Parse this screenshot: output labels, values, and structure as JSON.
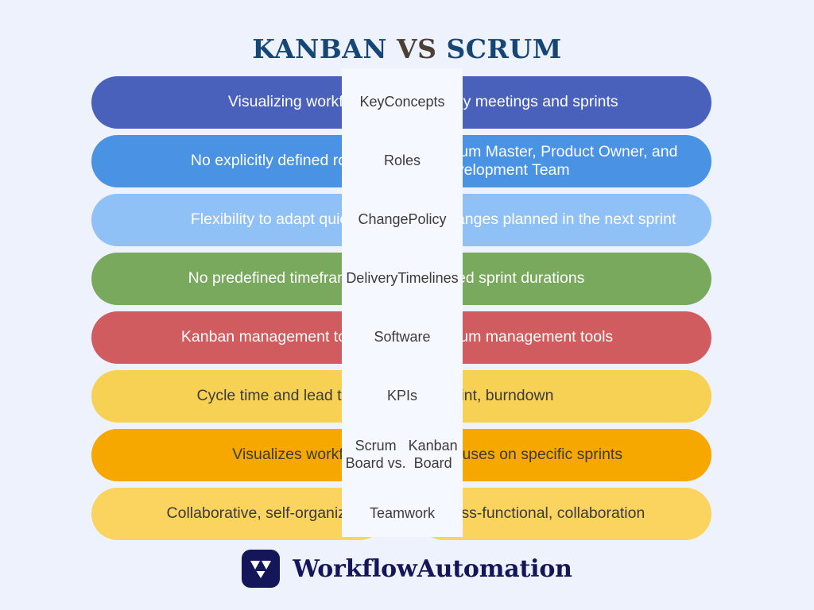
{
  "title": {
    "part1": "KANBAN",
    "vs": "VS",
    "part2": "SCRUM"
  },
  "theme": {
    "background": "#eef2fd",
    "center_panel": "#f5f8fe",
    "title_color": "#164675",
    "vs_color": "#4c4034",
    "logo_color": "#151559"
  },
  "comparison": {
    "rows": [
      {
        "label": "Key\nConcepts",
        "label_line1": "Key",
        "label_line2": "Concepts",
        "kanban": "Visualizing workflow",
        "scrum": "Daily meetings and sprints",
        "color": "#4a61bb",
        "text_color": "#ffffff"
      },
      {
        "label": "Roles",
        "label_line1": "Roles",
        "label_line2": "",
        "kanban": "No explicitly defined roles",
        "scrum": "Scrum Master, Product Owner, and Development Team",
        "color": "#4a93e4",
        "text_color": "#ffffff"
      },
      {
        "label": "Change\nPolicy",
        "label_line1": "Change",
        "label_line2": "Policy",
        "kanban": "Flexibility to adapt quickly",
        "scrum": "Changes planned in the next sprint",
        "color": "#8fc1f6",
        "text_color": "#ffffff"
      },
      {
        "label": "Delivery\nTimelines",
        "label_line1": "Delivery",
        "label_line2": "Timelines",
        "kanban": "No predefined timeframes",
        "scrum": "Fixed sprint durations",
        "color": "#78a95d",
        "text_color": "#ffffff"
      },
      {
        "label": "Software",
        "label_line1": "Software",
        "label_line2": "",
        "kanban": "Kanban management tools",
        "scrum": "Scrum management tools",
        "color": "#d15c5f",
        "text_color": "#ffffff"
      },
      {
        "label": "KPIs",
        "label_line1": "KPIs",
        "label_line2": "",
        "kanban": "Cycle time and lead time",
        "scrum": "Sprint, burndown",
        "color": "#f7d154",
        "text_color": "#3b3b3b"
      },
      {
        "label": "Scrum Board vs.\nKanban Board",
        "label_line1": "Scrum Board vs.",
        "label_line2": "Kanban Board",
        "kanban": "Visualizes workflow",
        "scrum": "Focuses on specific sprints",
        "color": "#f7a800",
        "text_color": "#3b3b3b"
      },
      {
        "label": "Teamwork",
        "label_line1": "Teamwork",
        "label_line2": "",
        "kanban": "Collaborative, self-organizing",
        "scrum": "Cross-functional, collaboration",
        "color": "#fad45f",
        "text_color": "#3b3b3b"
      }
    ]
  },
  "footer": {
    "brand": "WorkflowAutomation",
    "logo_icon": "w-monogram-icon"
  }
}
